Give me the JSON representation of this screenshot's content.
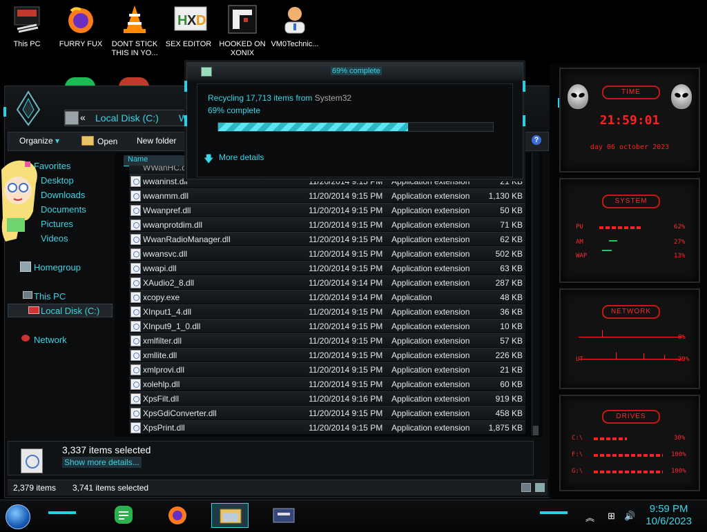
{
  "desktop": {
    "icons": [
      {
        "label": "This PC",
        "icon": "computer-icon"
      },
      {
        "label": "FURRY FUX",
        "icon": "firefox-icon"
      },
      {
        "label": "DONT STICK THIS IN YO...",
        "icon": "vlc-cone-icon"
      },
      {
        "label": "SEX EDITOR",
        "icon": "hxd-editor-icon"
      },
      {
        "label": "HOOKED ON XONIX",
        "icon": "xonix-game-icon"
      },
      {
        "label": "VM0Technic...",
        "icon": "technician-avatar-icon"
      }
    ]
  },
  "explorer": {
    "address": {
      "back_crumb": "«",
      "location": "Local Disk (C:)",
      "trail": "W"
    },
    "toolbar": {
      "organize": "Organize",
      "organize_arrow": "▾",
      "open": "Open",
      "new_folder": "New folder",
      "help": "?"
    },
    "nav": {
      "favorites": "Favorites",
      "desktop": "Desktop",
      "downloads": "Downloads",
      "documents": "Documents",
      "pictures": "Pictures",
      "videos": "Videos",
      "homegroup": "Homegroup",
      "this_pc": "This PC",
      "local_disk": "Local Disk (C:)",
      "network": "Network"
    },
    "columns": {
      "name": "Name"
    },
    "partial_row": "WWanHC.dll",
    "files": [
      {
        "name": "wwaninst.dll",
        "date": "11/20/2014 9:15 PM",
        "type": "Application extension",
        "size": "21 KB"
      },
      {
        "name": "wwanmm.dll",
        "date": "11/20/2014 9:15 PM",
        "type": "Application extension",
        "size": "1,130 KB"
      },
      {
        "name": "Wwanpref.dll",
        "date": "11/20/2014 9:15 PM",
        "type": "Application extension",
        "size": "50 KB"
      },
      {
        "name": "wwanprotdim.dll",
        "date": "11/20/2014 9:15 PM",
        "type": "Application extension",
        "size": "71 KB"
      },
      {
        "name": "WwanRadioManager.dll",
        "date": "11/20/2014 9:15 PM",
        "type": "Application extension",
        "size": "62 KB"
      },
      {
        "name": "wwansvc.dll",
        "date": "11/20/2014 9:15 PM",
        "type": "Application extension",
        "size": "502 KB"
      },
      {
        "name": "wwapi.dll",
        "date": "11/20/2014 9:15 PM",
        "type": "Application extension",
        "size": "63 KB"
      },
      {
        "name": "XAudio2_8.dll",
        "date": "11/20/2014 9:14 PM",
        "type": "Application extension",
        "size": "287 KB"
      },
      {
        "name": "xcopy.exe",
        "date": "11/20/2014 9:14 PM",
        "type": "Application",
        "size": "48 KB"
      },
      {
        "name": "XInput1_4.dll",
        "date": "11/20/2014 9:15 PM",
        "type": "Application extension",
        "size": "36 KB"
      },
      {
        "name": "XInput9_1_0.dll",
        "date": "11/20/2014 9:15 PM",
        "type": "Application extension",
        "size": "10 KB"
      },
      {
        "name": "xmlfilter.dll",
        "date": "11/20/2014 9:15 PM",
        "type": "Application extension",
        "size": "57 KB"
      },
      {
        "name": "xmllite.dll",
        "date": "11/20/2014 9:15 PM",
        "type": "Application extension",
        "size": "226 KB"
      },
      {
        "name": "xmlprovi.dll",
        "date": "11/20/2014 9:15 PM",
        "type": "Application extension",
        "size": "21 KB"
      },
      {
        "name": "xolehlp.dll",
        "date": "11/20/2014 9:15 PM",
        "type": "Application extension",
        "size": "60 KB"
      },
      {
        "name": "XpsFilt.dll",
        "date": "11/20/2014 9:16 PM",
        "type": "Application extension",
        "size": "919 KB"
      },
      {
        "name": "XpsGdiConverter.dll",
        "date": "11/20/2014 9:15 PM",
        "type": "Application extension",
        "size": "458 KB"
      },
      {
        "name": "XpsPrint.dll",
        "date": "11/20/2014 9:15 PM",
        "type": "Application extension",
        "size": "1,875 KB"
      }
    ],
    "details": {
      "title": "3,337 items selected",
      "link": "Show more details..."
    },
    "status": {
      "count": "2,379 items",
      "selected": "3,741 items selected"
    }
  },
  "dialog": {
    "title": "69% complete",
    "line1_prefix": "Recycling 17,713 items from ",
    "line1_source": "System32",
    "line2": "69% complete",
    "progress": 0.69,
    "more": "More details",
    "more_arrow": "🡇"
  },
  "gadgets": {
    "time": {
      "title": "TIME",
      "clock": "21:59:01",
      "date": "day 06 october 2023"
    },
    "system": {
      "title": "SYSTEM",
      "rows": [
        {
          "label": "PU",
          "value": "62%"
        },
        {
          "label": "AM",
          "value": "27%"
        },
        {
          "label": "WAP",
          "value": "13%"
        }
      ]
    },
    "network": {
      "title": "NETWORK",
      "rows": [
        {
          "label": "",
          "value": "0%"
        },
        {
          "label": "UT",
          "value": "29%"
        }
      ]
    },
    "drives": {
      "title": "DRIVES",
      "rows": [
        {
          "label": "C:\\",
          "value": "30%"
        },
        {
          "label": "F:\\",
          "value": "100%"
        },
        {
          "label": "G:\\",
          "value": "100%"
        }
      ]
    }
  },
  "taskbar": {
    "apps": [
      "feedly-icon",
      "firefox-icon",
      "file-explorer-icon",
      "control-panel-icon"
    ],
    "time": "9:59 PM",
    "date": "10/6/2023"
  },
  "colors": {
    "accent_cyan": "#39d6e8",
    "gadget_red": "#ff2020"
  }
}
